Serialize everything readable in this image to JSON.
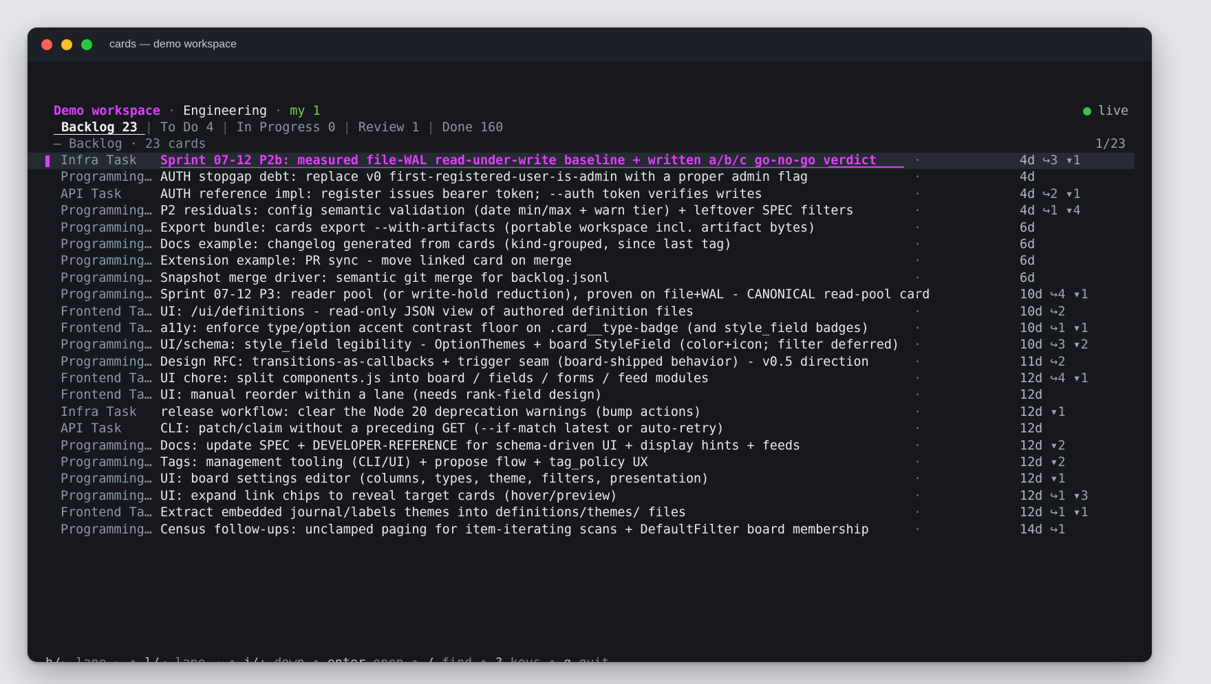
{
  "window": {
    "title": "cards — demo workspace"
  },
  "breadcrumb": {
    "workspace": "Demo workspace",
    "sep": " · ",
    "board": "Engineering",
    "filter": "my 1"
  },
  "status": {
    "label": "live",
    "color": "#3fbf4f"
  },
  "tabs": [
    {
      "label": " Backlog 23 ",
      "active": true
    },
    {
      "label": " To Do 4 ",
      "active": false
    },
    {
      "label": " In Progress 0 ",
      "active": false
    },
    {
      "label": " Review 1 ",
      "active": false
    },
    {
      "label": " Done 160",
      "active": false
    }
  ],
  "tab_separator": "|",
  "lane": {
    "header": "— Backlog · 23 cards",
    "position": "1/23"
  },
  "cards": [
    {
      "kind": "Infra Task",
      "title": "Sprint 07-12 P2b: measured file-WAL read-under-write baseline + written a/b/c go-no-go verdict",
      "dot": "·",
      "age": "4d",
      "meta": "↪3 ▾1",
      "selected": true
    },
    {
      "kind": "Programming…",
      "title": "AUTH stopgap debt: replace v0 first-registered-user-is-admin with a proper admin flag",
      "dot": "·",
      "age": "4d",
      "meta": ""
    },
    {
      "kind": "API Task",
      "title": "AUTH reference impl: register issues bearer token; --auth token verifies writes",
      "dot": "·",
      "age": "4d",
      "meta": "↪2 ▾1"
    },
    {
      "kind": "Programming…",
      "title": "P2 residuals: config semantic validation (date min/max + warn tier) + leftover SPEC filters",
      "dot": "·",
      "age": "4d",
      "meta": "↪1 ▾4"
    },
    {
      "kind": "Programming…",
      "title": "Export bundle: cards export --with-artifacts (portable workspace incl. artifact bytes)",
      "dot": "·",
      "age": "6d",
      "meta": ""
    },
    {
      "kind": "Programming…",
      "title": "Docs example: changelog generated from cards (kind-grouped, since last tag)",
      "dot": "·",
      "age": "6d",
      "meta": ""
    },
    {
      "kind": "Programming…",
      "title": "Extension example: PR sync - move linked card on merge",
      "dot": "·",
      "age": "6d",
      "meta": ""
    },
    {
      "kind": "Programming…",
      "title": "Snapshot merge driver: semantic git merge for backlog.jsonl",
      "dot": "·",
      "age": "6d",
      "meta": ""
    },
    {
      "kind": "Programming…",
      "title": "Sprint 07-12 P3: reader pool (or write-hold reduction), proven on file+WAL - CANONICAL read-pool card",
      "dot": "·",
      "age": "10d",
      "meta": "↪4 ▾1"
    },
    {
      "kind": "Frontend Ta…",
      "title": "UI: /ui/definitions - read-only JSON view of authored definition files",
      "dot": "·",
      "age": "10d",
      "meta": "↪2"
    },
    {
      "kind": "Frontend Ta…",
      "title": "a11y: enforce type/option accent contrast floor on .card__type-badge (and style_field badges)",
      "dot": "·",
      "age": "10d",
      "meta": "↪1 ▾1"
    },
    {
      "kind": "Programming…",
      "title": "UI/schema: style_field legibility - OptionThemes + board StyleField (color+icon; filter deferred)",
      "dot": "·",
      "age": "10d",
      "meta": "↪3 ▾2"
    },
    {
      "kind": "Programming…",
      "title": "Design RFC: transitions-as-callbacks + trigger seam (board-shipped behavior) - v0.5 direction",
      "dot": "·",
      "age": "11d",
      "meta": "↪2"
    },
    {
      "kind": "Frontend Ta…",
      "title": "UI chore: split components.js into board / fields / forms / feed modules",
      "dot": "·",
      "age": "12d",
      "meta": "↪4 ▾1"
    },
    {
      "kind": "Frontend Ta…",
      "title": "UI: manual reorder within a lane (needs rank-field design)",
      "dot": "·",
      "age": "12d",
      "meta": ""
    },
    {
      "kind": "Infra Task",
      "title": "release workflow: clear the Node 20 deprecation warnings (bump actions)",
      "dot": "·",
      "age": "12d",
      "meta": "▾1"
    },
    {
      "kind": "API Task",
      "title": "CLI: patch/claim without a preceding GET (--if-match latest or auto-retry)",
      "dot": "·",
      "age": "12d",
      "meta": ""
    },
    {
      "kind": "Programming…",
      "title": "Docs: update SPEC + DEVELOPER-REFERENCE for schema-driven UI + display hints + feeds",
      "dot": "·",
      "age": "12d",
      "meta": "▾2"
    },
    {
      "kind": "Programming…",
      "title": "Tags: management tooling (CLI/UI) + propose flow + tag_policy UX",
      "dot": "·",
      "age": "12d",
      "meta": "▾2"
    },
    {
      "kind": "Programming…",
      "title": "UI: board settings editor (columns, types, theme, filters, presentation)",
      "dot": "·",
      "age": "12d",
      "meta": "▾1"
    },
    {
      "kind": "Programming…",
      "title": "UI: expand link chips to reveal target cards (hover/preview)",
      "dot": "·",
      "age": "12d",
      "meta": "↪1 ▾3"
    },
    {
      "kind": "Frontend Ta…",
      "title": "Extract embedded journal/labels themes into definitions/themes/ files",
      "dot": "·",
      "age": "12d",
      "meta": "↪1 ▾1"
    },
    {
      "kind": "Programming…",
      "title": "Census follow-ups: unclamped paging for item-iterating scans + DefaultFilter board membership",
      "dot": "·",
      "age": "14d",
      "meta": "↪1"
    }
  ],
  "footer": {
    "keys": [
      {
        "key": "h/←",
        "action": "lane ←"
      },
      {
        "key": "l/→",
        "action": "lane →"
      },
      {
        "key": "j/↓",
        "action": "down"
      },
      {
        "key": "enter",
        "action": "open"
      },
      {
        "key": "/",
        "action": "find"
      },
      {
        "key": "?",
        "action": "keys"
      },
      {
        "key": "q",
        "action": "quit"
      }
    ],
    "separator": " • "
  }
}
